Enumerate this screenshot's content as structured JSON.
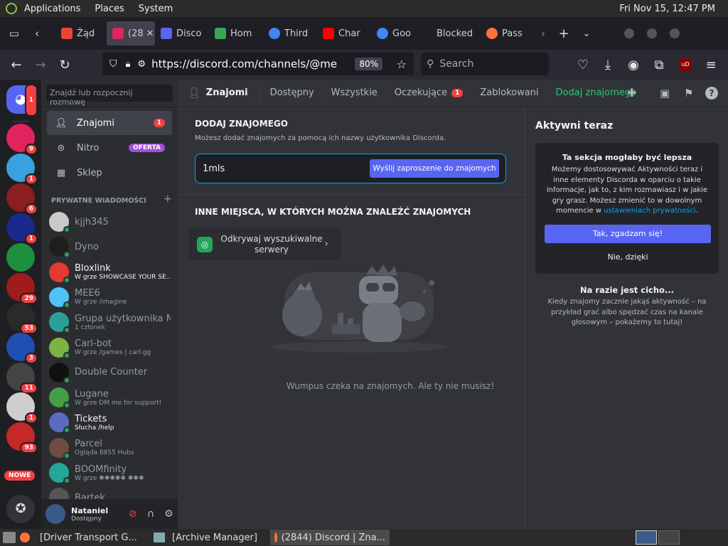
{
  "system_bar": {
    "menus": [
      "Applications",
      "Places",
      "System"
    ],
    "clock": "Fri Nov 15, 12:47 PM"
  },
  "browser": {
    "tabs": [
      {
        "label": "Żąd",
        "color": "#ea4335"
      },
      {
        "label": "(28",
        "color": "#e0245e"
      },
      {
        "label": "Disco",
        "color": "#5865f2"
      },
      {
        "label": "Hom",
        "color": "#34a853"
      },
      {
        "label": "Third",
        "color": "#4285f4"
      },
      {
        "label": "Char",
        "color": "#ff0000"
      },
      {
        "label": "Goo",
        "color": "#4285f4"
      },
      {
        "label": "Blocked",
        "color": "#1f1e25"
      },
      {
        "label": "Pass",
        "color": "#ff7139"
      }
    ],
    "url": "https://discord.com/channels/@me",
    "zoom": "80%",
    "search_placeholder": "Search"
  },
  "guilds": {
    "items": [
      {
        "badge": "1",
        "color": "#5865f2"
      },
      {
        "badge": "9",
        "color": "#e0245e"
      },
      {
        "badge": "1",
        "color": "#3aa0e0"
      },
      {
        "badge": "6",
        "color": "#8b1e1e"
      },
      {
        "badge": "1",
        "color": "#1a2a8a"
      },
      {
        "badge": "",
        "color": "#1d8f3c"
      },
      {
        "badge": "29",
        "color": "#9e1c1c"
      },
      {
        "badge": "53",
        "color": "#2a2a2a"
      },
      {
        "badge": "3",
        "color": "#1f4fb0"
      },
      {
        "badge": "11",
        "color": "#444444"
      },
      {
        "badge": "1",
        "color": "#cfcfcf"
      },
      {
        "badge": "93",
        "color": "#c62828"
      }
    ],
    "new_label": "NOWE"
  },
  "dm_sidebar": {
    "search_placeholder": "Znajdź lub rozpocznij rozmowę",
    "nav": [
      {
        "label": "Znajomi",
        "badge": "1"
      },
      {
        "label": "Nitro",
        "badge": "OFERTA"
      },
      {
        "label": "Sklep",
        "badge": ""
      }
    ],
    "section_title": "PRYWATNE WIADOMOŚCI",
    "add_symbol": "+",
    "dms": [
      {
        "name": "kjjh345",
        "sub": "",
        "color": "#c9c9c9",
        "bold": false
      },
      {
        "name": "Dyno",
        "sub": "",
        "color": "#1e1e1e",
        "bold": false
      },
      {
        "name": "Bloxlink",
        "sub": "W grze SHOWCASE YOUR SE...",
        "color": "#e53935",
        "bold": true
      },
      {
        "name": "MEE6",
        "sub": "W grze /imagine",
        "color": "#4fc3f7",
        "bold": false
      },
      {
        "name": "Grupa użytkownika N...",
        "sub": "1 członek",
        "color": "#2aa198",
        "bold": false
      },
      {
        "name": "Carl-bot",
        "sub": "W grze /games | carl.gg",
        "color": "#7cb342",
        "bold": false
      },
      {
        "name": "Double Counter",
        "sub": "",
        "color": "#111111",
        "bold": false
      },
      {
        "name": "Lugane",
        "sub": "W grze DM me for support!",
        "color": "#43a047",
        "bold": false
      },
      {
        "name": "Tickets",
        "sub": "Słucha /help",
        "color": "#5c6bc0",
        "bold": true
      },
      {
        "name": "Parcel",
        "sub": "Ogląda 8855 Hubs",
        "color": "#6d4c41",
        "bold": false
      },
      {
        "name": "BOOMfinity",
        "sub": "W grze ✱✱✱✱✱ ✱✱✱",
        "color": "#26a69a",
        "bold": false
      },
      {
        "name": "Bartek",
        "sub": "",
        "color": "#555555",
        "bold": false
      }
    ]
  },
  "user_panel": {
    "name": "Nataniel",
    "status": "Dostępny"
  },
  "header": {
    "title": "Znajomi",
    "tabs": [
      "Dostępny",
      "Wszystkie",
      "Oczekujące",
      "Zablokowani"
    ],
    "pending_badge": "1",
    "add_friend": "Dodaj znajomego"
  },
  "add_friend": {
    "title": "DODAJ ZNAJOMEGO",
    "description": "Możesz dodać znajomych za pomocą ich nazwy użytkownika Discorda.",
    "input_value": "1mls",
    "send_button": "Wyślij zaproszenie do znajomych"
  },
  "other_places": {
    "title": "INNE MIEJSCA, W KTÓRYCH MOŻNA ZNALEŹĆ ZNAJOMYCH",
    "card_label": "Odkrywaj wyszukiwalne serwery"
  },
  "empty_state": {
    "text": "Wumpus czeka na znajomych. Ale ty nie musisz!"
  },
  "active_now": {
    "title": "Aktywni teraz",
    "card_title": "Ta sekcja mogłaby być lepsza",
    "card_body": "Możemy dostosowywać Aktywności teraz i inne elementy Discorda w oparciu o takie informacje, jak to, z kim rozmawiasz i w jakie gry grasz. Możesz zmienić to w dowolnym momencie w",
    "card_link": "ustawieniach prywatności",
    "card_period": ".",
    "accept_button": "Tak, zgadzam się!",
    "decline_button": "Nie, dzięki",
    "quiet_title": "Na razie jest cicho...",
    "quiet_body": "Kiedy znajomy zacznie jakąś aktywność – na przykład grać albo spędzać czas na kanale głosowym – pokażemy to tutaj!"
  },
  "taskbar": {
    "items": [
      "[Driver Transport G...",
      "[Archive Manager]",
      "(2844) Discord | Zna..."
    ]
  },
  "colors": {
    "accent": "#5865f2",
    "danger": "#f23f43",
    "online": "#23a55a",
    "add_friend_green": "#2dc770"
  }
}
